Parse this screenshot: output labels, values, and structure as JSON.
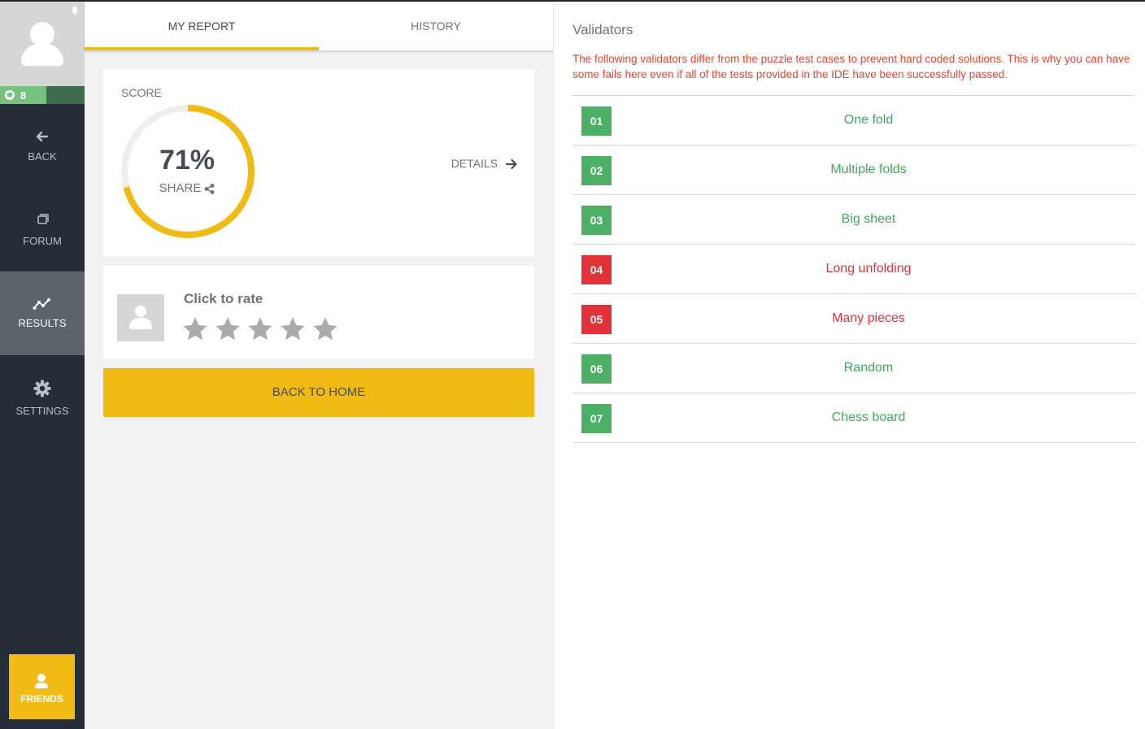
{
  "sidebar": {
    "level": "8",
    "items": [
      {
        "label": "BACK",
        "icon": "arrow-left-icon"
      },
      {
        "label": "FORUM",
        "icon": "forum-icon"
      },
      {
        "label": "RESULTS",
        "icon": "results-chart-icon"
      },
      {
        "label": "SETTINGS",
        "icon": "gear-icon"
      }
    ],
    "friends_label": "FRIENDS",
    "active_item": "RESULTS"
  },
  "tabs": [
    {
      "label": "MY REPORT",
      "active": true
    },
    {
      "label": "HISTORY",
      "active": false
    }
  ],
  "score": {
    "label": "SCORE",
    "value": "71%",
    "percent": 71,
    "share_label": "SHARE",
    "details_label": "DETAILS"
  },
  "rating": {
    "title": "Click to rate",
    "stars_total": 5,
    "stars_selected": 0
  },
  "home_button": "BACK TO HOME",
  "validators": {
    "title": "Validators",
    "note": "The following validators differ from the puzzle test cases to prevent hard coded solutions. This is why you can have some fails here even if all of the tests provided in the IDE have been successfully passed.",
    "items": [
      {
        "num": "01",
        "name": "One fold",
        "status": "pass"
      },
      {
        "num": "02",
        "name": "Multiple folds",
        "status": "pass"
      },
      {
        "num": "03",
        "name": "Big sheet",
        "status": "pass"
      },
      {
        "num": "04",
        "name": "Long unfolding",
        "status": "fail"
      },
      {
        "num": "05",
        "name": "Many pieces",
        "status": "fail"
      },
      {
        "num": "06",
        "name": "Random",
        "status": "pass"
      },
      {
        "num": "07",
        "name": "Chess board",
        "status": "pass"
      }
    ]
  },
  "colors": {
    "accent": "#f2bb13",
    "pass": "#4caf66",
    "fail": "#e03238",
    "sidebar": "#252e38"
  }
}
